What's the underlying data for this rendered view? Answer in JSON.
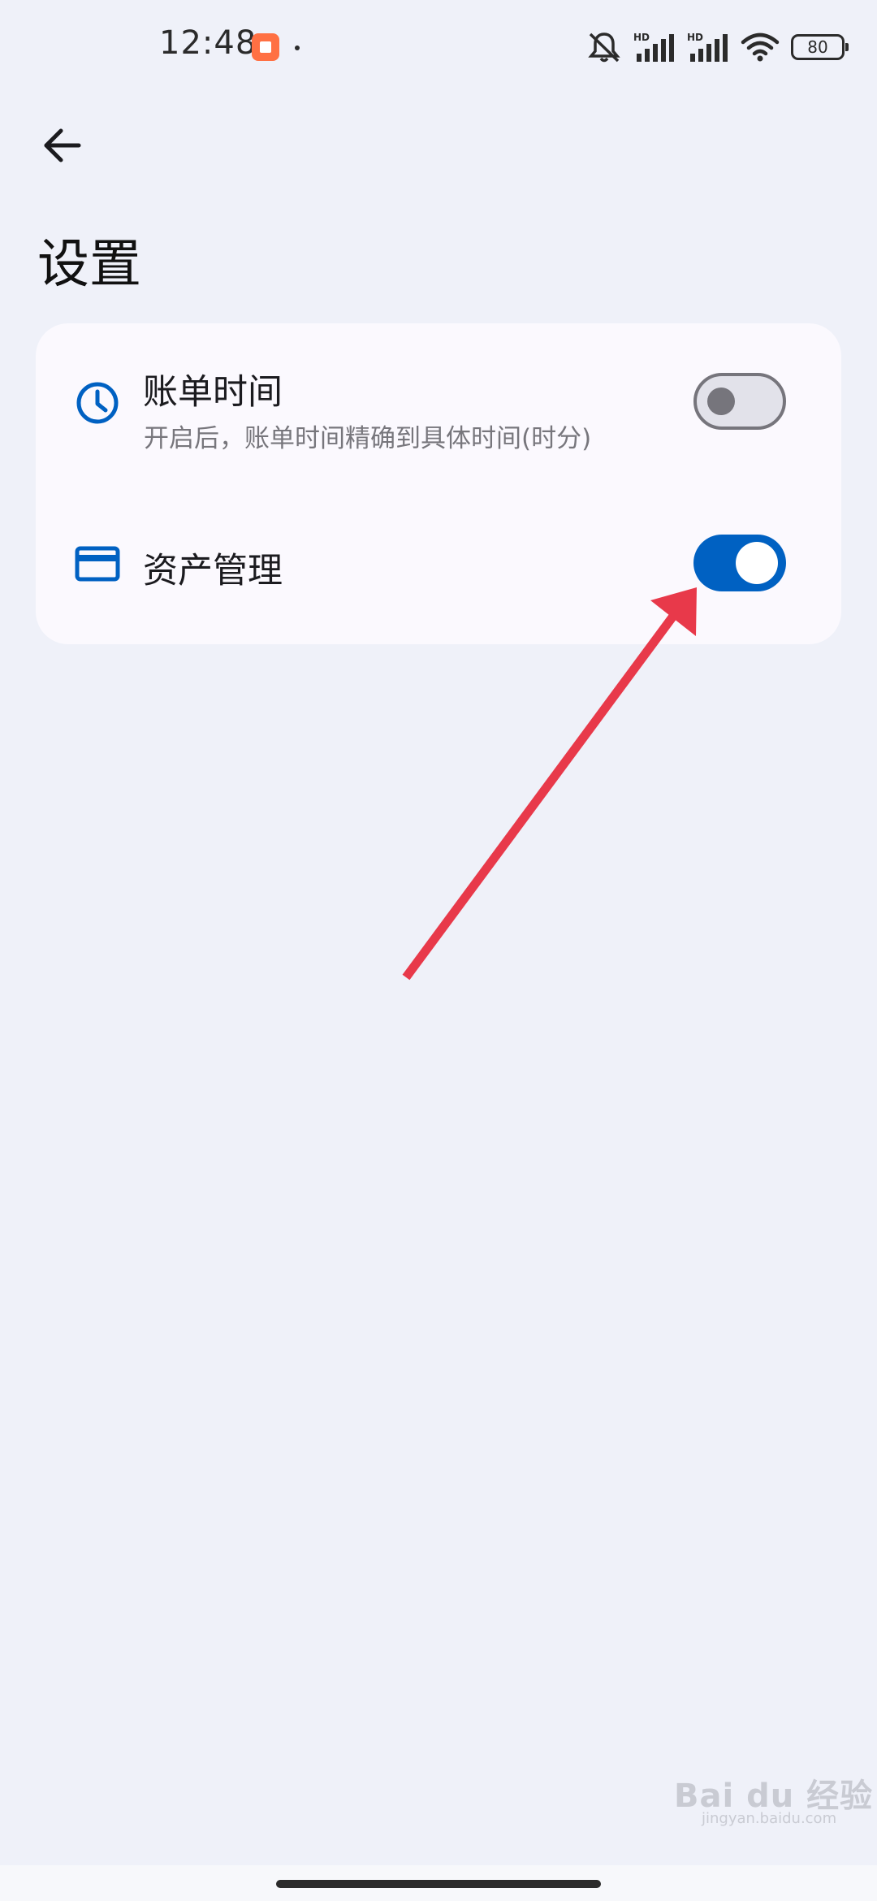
{
  "status_bar": {
    "time": "12:48",
    "battery": "80",
    "signal_label_1": "HD",
    "signal_label_2": "HD",
    "icons": [
      "app-notification-icon",
      "mute-icon",
      "signal-icon",
      "signal-icon",
      "wifi-icon",
      "battery-icon"
    ]
  },
  "header": {
    "back_icon": "arrow-left-icon",
    "title": "设置"
  },
  "settings": {
    "items": [
      {
        "icon": "clock-icon",
        "title": "账单时间",
        "subtitle": "开启后，账单时间精确到具体时间(时分)",
        "enabled": false
      },
      {
        "icon": "card-icon",
        "title": "资产管理",
        "enabled": true
      }
    ]
  },
  "colors": {
    "accent": "#0061c2",
    "background": "#eff1f9",
    "card": "#fbf9fe",
    "annotation": "#e8394a"
  },
  "watermark": {
    "text": "Bai du 经验",
    "url_text": "jingyan.baidu.com"
  }
}
